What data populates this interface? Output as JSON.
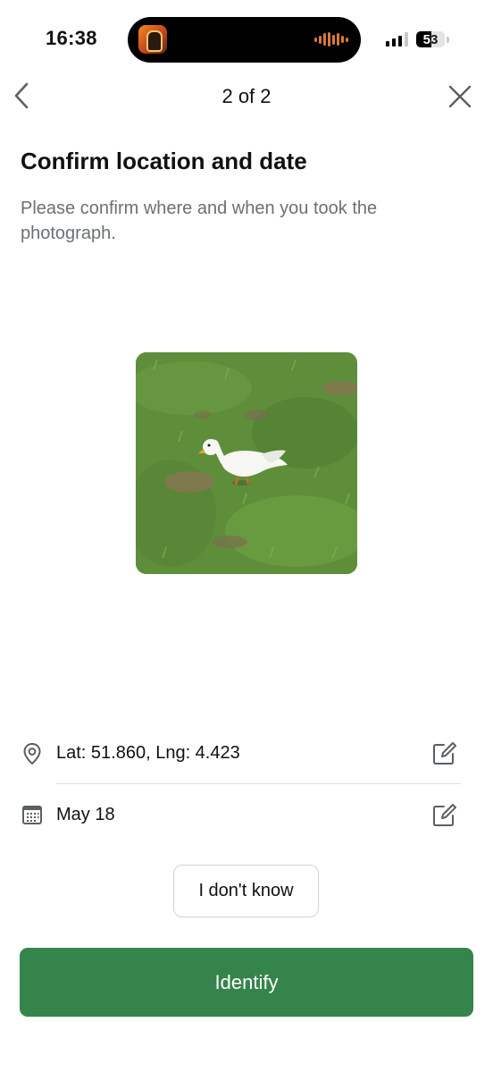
{
  "status_bar": {
    "time": "16:38",
    "battery_level": "53",
    "icons": [
      "app-icon",
      "audio-waveform-icon",
      "signal-icon",
      "battery-icon"
    ]
  },
  "nav": {
    "title": "2 of 2",
    "back_icon": "chevron-left-icon",
    "close_icon": "close-icon"
  },
  "header": {
    "title": "Confirm location and date",
    "subtitle": "Please confirm where and when you took the photograph."
  },
  "photo": {
    "subject": "white duck on grass"
  },
  "details": {
    "location": {
      "icon": "location-pin-icon",
      "text": "Lat: 51.860, Lng: 4.423",
      "edit_icon": "edit-icon"
    },
    "date": {
      "icon": "calendar-icon",
      "text": "May 18",
      "edit_icon": "edit-icon"
    }
  },
  "actions": {
    "unknown_label": "I don't know",
    "identify_label": "Identify"
  },
  "colors": {
    "primary": "#35844b",
    "subtitle_text": "#6a7076",
    "divider": "#dcdfe2"
  }
}
